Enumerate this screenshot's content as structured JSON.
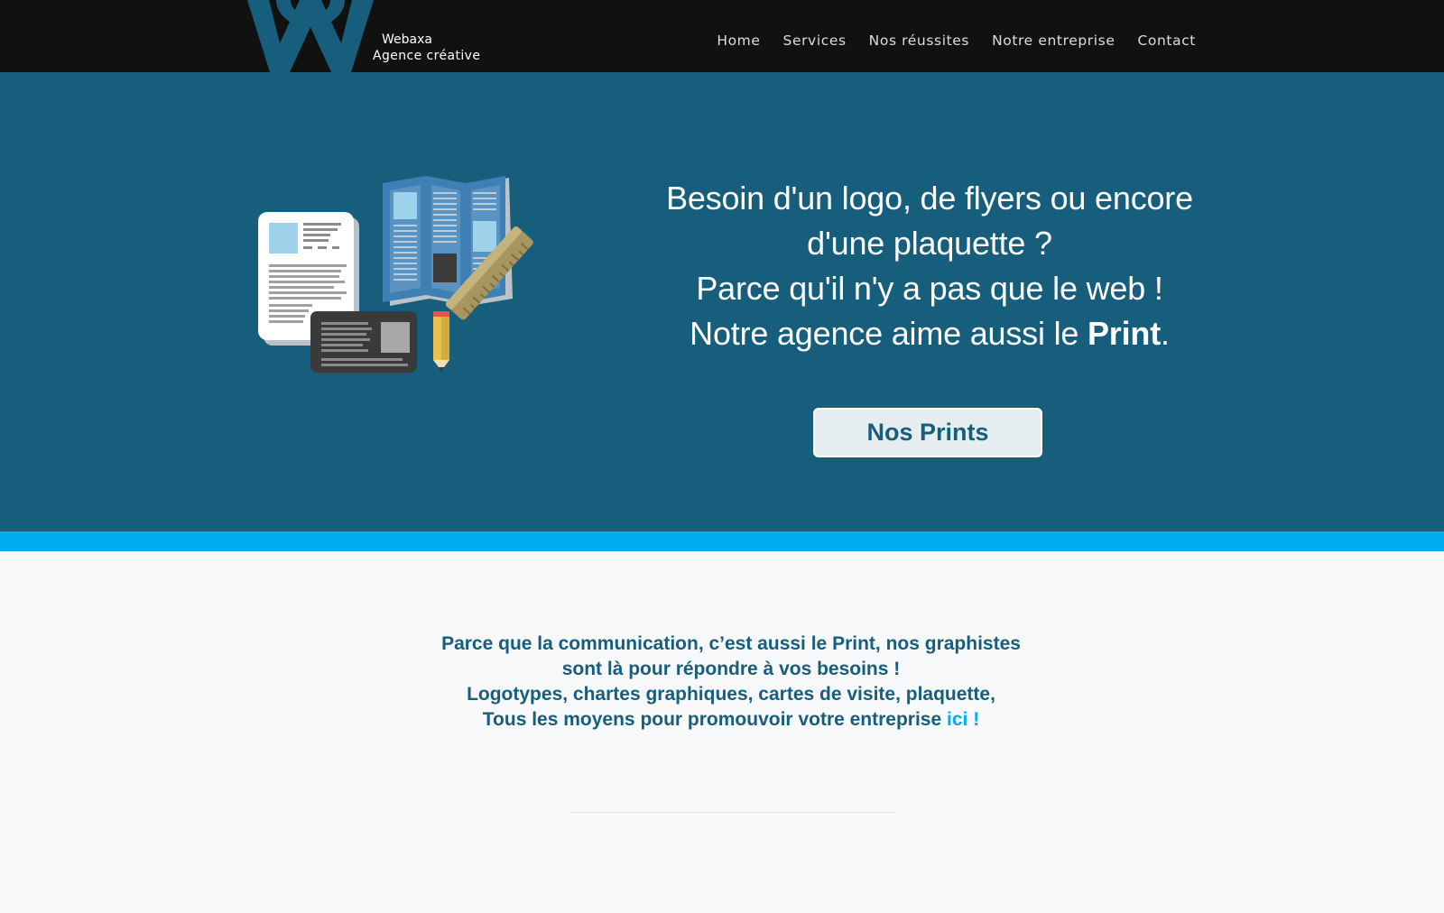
{
  "header": {
    "brand_name": "Webaxa",
    "brand_tagline": "Agence créative",
    "nav": [
      {
        "label": "Home"
      },
      {
        "label": "Services"
      },
      {
        "label": "Nos réussites"
      },
      {
        "label": "Notre entreprise"
      },
      {
        "label": "Contact"
      }
    ]
  },
  "hero": {
    "line1": "Besoin d'un logo, de flyers ou encore",
    "line2": "d'une plaquette ?",
    "line3": "Parce qu'il n'y a pas que le web !",
    "line4_prefix": "Notre agence aime aussi le ",
    "line4_bold": "Print",
    "line4_suffix": ".",
    "button_label": "Nos Prints",
    "illustration_icon": "print-materials-illustration"
  },
  "intro": {
    "line1": "Parce que la communication, c’est aussi le Print, nos graphistes",
    "line2": "sont là pour répondre à vos besoins !",
    "line3": "Logotypes, chartes graphiques, cartes de visite, plaquette,",
    "line4_prefix": "Tous les moyens pour promouvoir votre entreprise ",
    "line4_link": "ici !"
  },
  "colors": {
    "header_bg": "#111111",
    "hero_bg": "#175e7d",
    "accent": "#00aeef",
    "page_bg": "#f8f9fa",
    "button_bg": "#e5edf1"
  }
}
